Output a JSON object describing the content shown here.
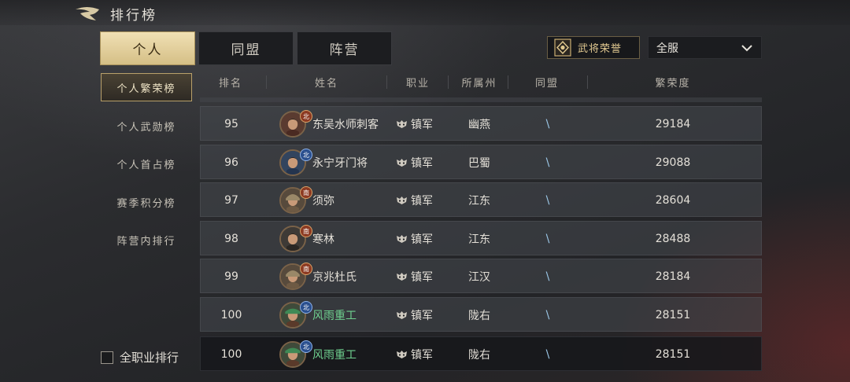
{
  "header": {
    "title": "排行榜"
  },
  "tabs": [
    {
      "label": "个人",
      "active": true
    },
    {
      "label": "同盟",
      "active": false
    },
    {
      "label": "阵营",
      "active": false
    }
  ],
  "honor_button": {
    "label": "武将荣誉"
  },
  "server_select": {
    "value": "全服"
  },
  "sidebar": {
    "items": [
      {
        "label": "个人繁荣榜",
        "active": true
      },
      {
        "label": "个人武勋榜",
        "active": false
      },
      {
        "label": "个人首占榜",
        "active": false
      },
      {
        "label": "赛季积分榜",
        "active": false
      },
      {
        "label": "阵营内排行",
        "active": false
      }
    ]
  },
  "all_jobs_checkbox": {
    "label": "全职业排行",
    "checked": false
  },
  "table": {
    "columns": [
      "排名",
      "姓名",
      "职业",
      "所属州",
      "同盟",
      "繁荣度"
    ],
    "rows": [
      {
        "rank": "95",
        "name": "东吴水师刺客",
        "job": "镇军",
        "region": "幽燕",
        "alliance": "\\",
        "prosperity": "29184",
        "badge": "北",
        "badge_color": "red",
        "avatar": "avatar-red"
      },
      {
        "rank": "96",
        "name": "永宁牙门将",
        "job": "镇军",
        "region": "巴蜀",
        "alliance": "\\",
        "prosperity": "29088",
        "badge": "北",
        "badge_color": "blue",
        "avatar": "avatar-blue"
      },
      {
        "rank": "97",
        "name": "须弥",
        "job": "镇军",
        "region": "江东",
        "alliance": "\\",
        "prosperity": "28604",
        "badge": "南",
        "badge_color": "red",
        "avatar": "avatar-helmet"
      },
      {
        "rank": "98",
        "name": "寒林",
        "job": "镇军",
        "region": "江东",
        "alliance": "\\",
        "prosperity": "28488",
        "badge": "南",
        "badge_color": "red",
        "avatar": "avatar-dark"
      },
      {
        "rank": "99",
        "name": "京兆杜氏",
        "job": "镇军",
        "region": "江汉",
        "alliance": "\\",
        "prosperity": "28184",
        "badge": "南",
        "badge_color": "red",
        "avatar": "avatar-helmet"
      },
      {
        "rank": "100",
        "name": "风雨重工",
        "job": "镇军",
        "region": "陇右",
        "alliance": "\\",
        "prosperity": "28151",
        "badge": "北",
        "badge_color": "blue",
        "avatar": "avatar-green",
        "highlight": true
      }
    ],
    "self_row": {
      "rank": "100",
      "name": "风雨重工",
      "job": "镇军",
      "region": "陇右",
      "alliance": "\\",
      "prosperity": "28151",
      "badge": "北",
      "badge_color": "blue",
      "avatar": "avatar-green",
      "highlight": true
    }
  },
  "colors": {
    "gold_active": "#e6d3a0",
    "highlight_name": "#6fd08f",
    "faction_red": "#8c3a22",
    "faction_blue": "#2a4f8e"
  }
}
